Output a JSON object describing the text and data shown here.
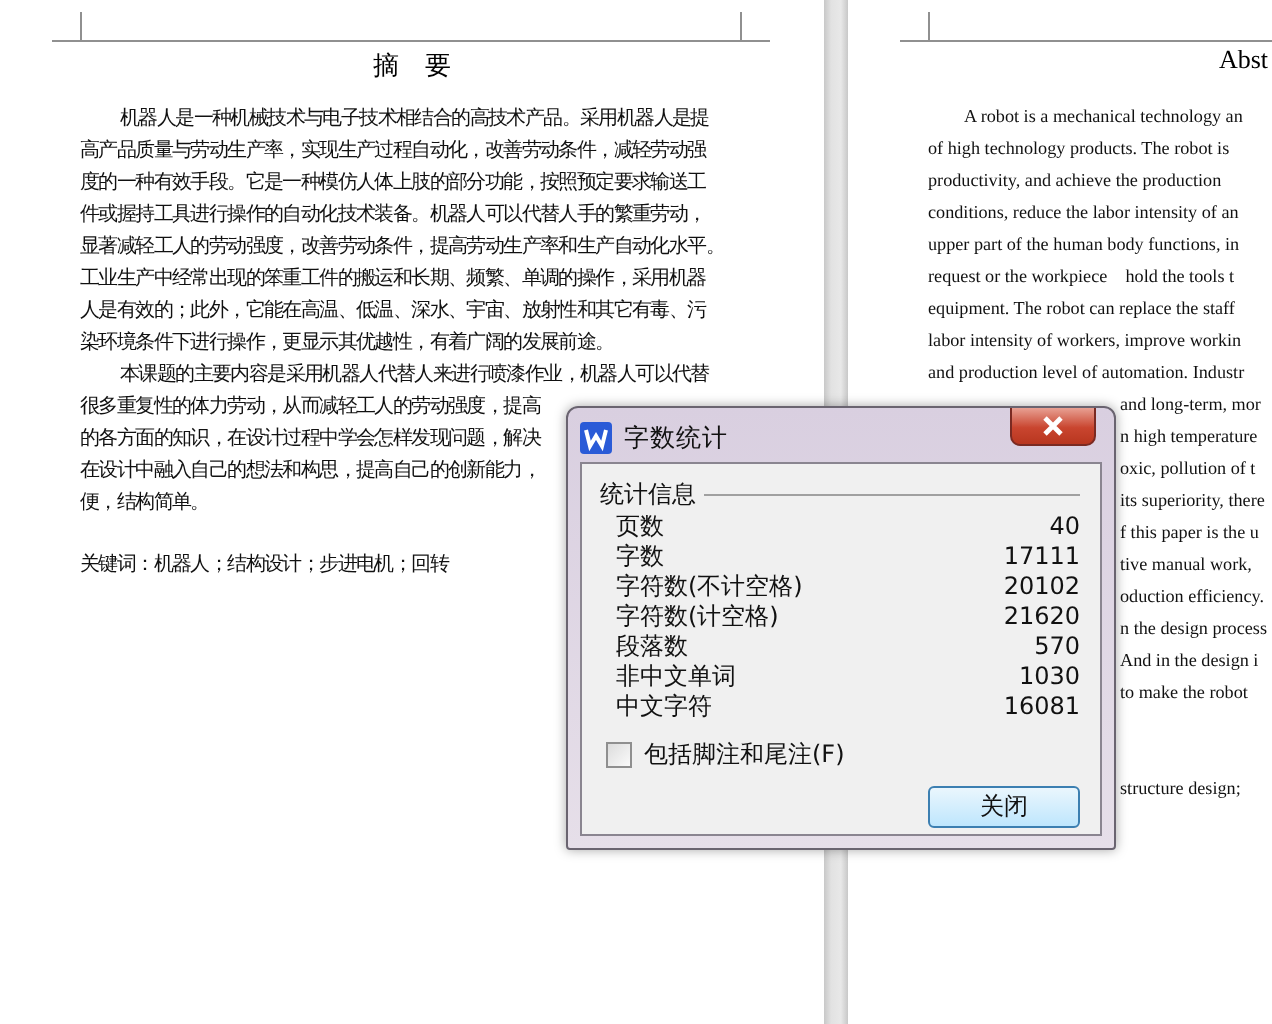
{
  "left_page": {
    "title": "摘　要",
    "paragraphs": [
      {
        "lines": [
          "机器人是一种机械技术与电子技术相结合的高技术产品。采用机器人是提",
          "高产品质量与劳动生产率，实现生产过程自动化，改善劳动条件，减轻劳动强",
          "度的一种有效手段。它是一种模仿人体上肢的部分功能，按照预定要求输送工",
          "件或握持工具进行操作的自动化技术装备。机器人可以代替人手的繁重劳动，",
          "显著减轻工人的劳动强度，改善劳动条件，提高劳动生产率和生产自动化水平。",
          "工业生产中经常出现的笨重工件的搬运和长期、频繁、单调的操作，采用机器",
          "人是有效的；此外，它能在高温、低温、深水、宇宙、放射性和其它有毒、污",
          "染环境条件下进行操作，更显示其优越性，有着广阔的发展前途。"
        ]
      },
      {
        "lines": [
          "本课题的主要内容是采用机器人代替人来进行喷漆作业，机器人可以代替",
          "很多重复性的体力劳动，从而减轻工人的劳动强度，提高",
          "的各方面的知识，在设计过程中学会怎样发现问题，解决",
          "在设计中融入自己的想法和构思，提高自己的创新能力，",
          "便，结构简单。"
        ]
      }
    ],
    "keywords": "关键词：机器人；结构设计；步进电机；回转"
  },
  "right_page": {
    "title": "Abst",
    "lines": [
      {
        "kind": "indent",
        "text": "A robot is a mechanical technology an"
      },
      {
        "kind": "full",
        "text": "of high technology products. The robot is"
      },
      {
        "kind": "full",
        "text": "productivity, and achieve the production"
      },
      {
        "kind": "full",
        "text": "conditions, reduce the labor intensity of an"
      },
      {
        "kind": "full",
        "text": "upper part of the human body functions, in"
      },
      {
        "kind": "full",
        "text": "request or the workpiece    hold the tools t"
      },
      {
        "kind": "full",
        "text": "equipment. The robot can replace the staff"
      },
      {
        "kind": "full",
        "text": "labor intensity of workers, improve workin"
      },
      {
        "kind": "full",
        "text": "and production level of automation. Industr"
      },
      {
        "kind": "clipped",
        "text": "and long-term, mor"
      },
      {
        "kind": "clipped",
        "text": "n high temperature"
      },
      {
        "kind": "clipped",
        "text": "oxic, pollution of t"
      },
      {
        "kind": "clipped",
        "text": "its superiority, there"
      },
      {
        "kind": "clipped",
        "text": "f this paper is the u"
      },
      {
        "kind": "clipped",
        "text": "tive manual work,"
      },
      {
        "kind": "clipped",
        "text": "oduction efficiency."
      },
      {
        "kind": "clipped",
        "text": "n the design process"
      },
      {
        "kind": "clipped",
        "text": "And in the design i"
      },
      {
        "kind": "clipped",
        "text": "to make the robot"
      }
    ],
    "keywords": "structure design;"
  },
  "dialog": {
    "title": "字数统计",
    "group": "统计信息",
    "stats": [
      {
        "label": "页数",
        "value": "40"
      },
      {
        "label": "字数",
        "value": "17111"
      },
      {
        "label": "字符数(不计空格)",
        "value": "20102"
      },
      {
        "label": "字符数(计空格)",
        "value": "21620"
      },
      {
        "label": "段落数",
        "value": "570"
      },
      {
        "label": "非中文单词",
        "value": "1030"
      },
      {
        "label": "中文字符",
        "value": "16081"
      }
    ],
    "checkbox": {
      "label": "包括脚注和尾注(F)",
      "checked": false
    },
    "button": "关闭"
  }
}
